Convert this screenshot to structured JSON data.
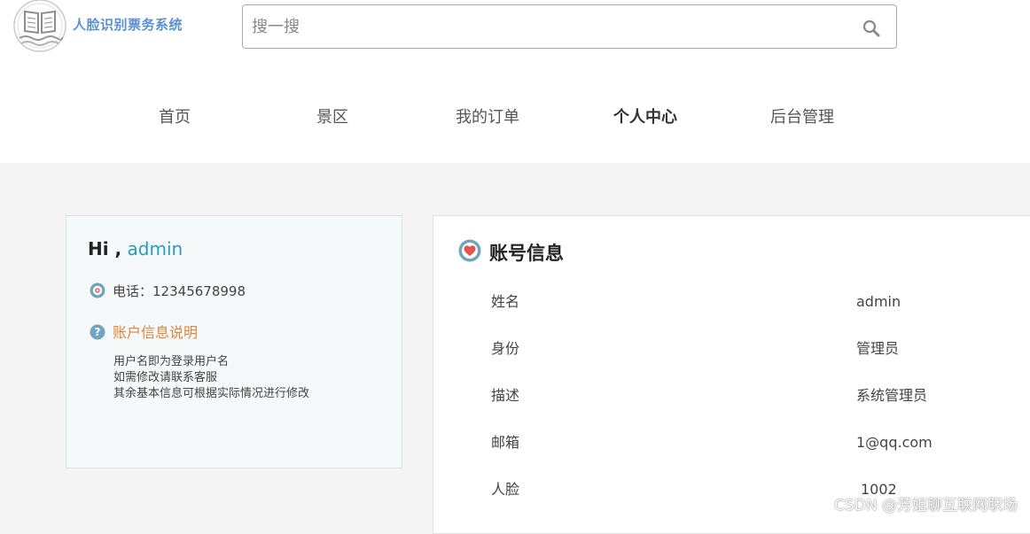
{
  "app": {
    "logo_text": "人脸识别票务系统"
  },
  "search": {
    "placeholder": "搜一搜",
    "value": ""
  },
  "nav": {
    "items": [
      {
        "label": "首页",
        "active": false
      },
      {
        "label": "景区",
        "active": false
      },
      {
        "label": "我的订单",
        "active": false
      },
      {
        "label": "个人中心",
        "active": true
      },
      {
        "label": "后台管理",
        "active": false
      }
    ]
  },
  "profile": {
    "greeting": "Hi ,",
    "username": "admin",
    "phone_label": "电话：",
    "phone": "12345678998",
    "help_title": "账户信息说明",
    "help_lines": [
      "用户名即为登录用户名",
      "如需修改请联系客服",
      "其余基本信息可根据实际情况进行修改"
    ]
  },
  "account": {
    "title": "账号信息",
    "fields": [
      {
        "label": "姓名",
        "value": "admin"
      },
      {
        "label": "身份",
        "value": "管理员"
      },
      {
        "label": "描述",
        "value": "系统管理员"
      },
      {
        "label": "邮箱",
        "value": "1@qq.com"
      },
      {
        "label": "人脸",
        "value": "1002"
      }
    ]
  },
  "watermark": "CSDN @芳姐聊互联网职场",
  "colors": {
    "logo": "#5c8fd0",
    "username": "#2a9bc0",
    "help_title": "#e0863a",
    "page_bg": "#f4f4f4"
  }
}
